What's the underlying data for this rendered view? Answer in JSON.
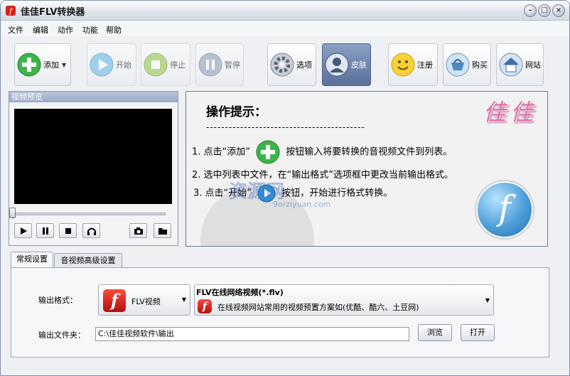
{
  "window": {
    "title": "佳佳FLV转换器"
  },
  "menu": [
    "文件",
    "编辑",
    "动作",
    "功能",
    "帮助"
  ],
  "toolbar": {
    "add": "添加",
    "start": "开始",
    "stop": "停止",
    "pause": "暂停",
    "options": "选项",
    "skin": "皮肤",
    "register": "注册",
    "buy": "购买",
    "website": "网站"
  },
  "preview": {
    "title": "视频预览",
    "seek_position": 0
  },
  "tips": {
    "title": "操作提示：",
    "separator": "------------------------------------------",
    "brand": "佳佳",
    "step1_a": "1. 点击“添加”",
    "step1_b": "按钮输入将要转换的音视频文件到列表。",
    "step2": "2. 选中列表中文件，在“输出格式”选项框中更改当前输出格式。",
    "step3_a": "3. 点击“开始”",
    "step3_b": "按钮，开始进行格式转换。",
    "watermark": "资源网",
    "watermark_url": "9orziyuan.com"
  },
  "tabs": [
    "常规设置",
    "音视频高级设置"
  ],
  "settings": {
    "format_label": "输出格式：",
    "format_value": "FLV视频",
    "preset_title": "FLV在线网络视频(*.flv)",
    "preset_desc": "在线视频网站常用的视频预置方案如(优酷、酷六、土豆网)",
    "folder_label": "输出文件夹：",
    "folder_value": "C:\\佳佳视频软件\\输出",
    "browse": "浏览",
    "open": "打开"
  },
  "colors": {
    "add_icon": "#3cb54a",
    "skin_active": "#5b7099",
    "flash_red": "#d3221a",
    "brand_pink": "#e06aa6"
  }
}
